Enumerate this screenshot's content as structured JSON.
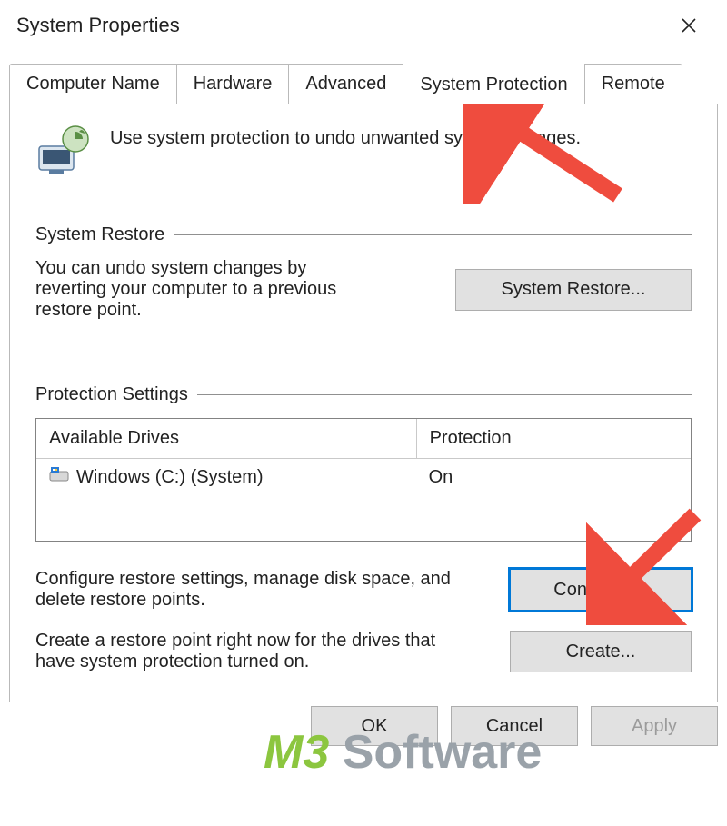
{
  "window": {
    "title": "System Properties"
  },
  "tabs": {
    "items": [
      {
        "label": "Computer Name",
        "active": false
      },
      {
        "label": "Hardware",
        "active": false
      },
      {
        "label": "Advanced",
        "active": false
      },
      {
        "label": "System Protection",
        "active": true
      },
      {
        "label": "Remote",
        "active": false
      }
    ]
  },
  "intro": "Use system protection to undo unwanted system changes.",
  "groups": {
    "restore": {
      "title": "System Restore",
      "desc": "You can undo system changes by reverting your computer to a previous restore point.",
      "button": "System Restore..."
    },
    "protection": {
      "title": "Protection Settings",
      "columns": {
        "drive": "Available Drives",
        "protection": "Protection"
      },
      "rows": [
        {
          "drive": "Windows (C:) (System)",
          "protection": "On"
        }
      ],
      "configure": {
        "desc": "Configure restore settings, manage disk space, and delete restore points.",
        "button": "Configure..."
      },
      "create": {
        "desc": "Create a restore point right now for the drives that have system protection turned on.",
        "button": "Create..."
      }
    }
  },
  "buttons": {
    "ok": "OK",
    "cancel": "Cancel",
    "apply": "Apply"
  },
  "watermark": {
    "part1": "M3",
    "part2": " Software"
  }
}
